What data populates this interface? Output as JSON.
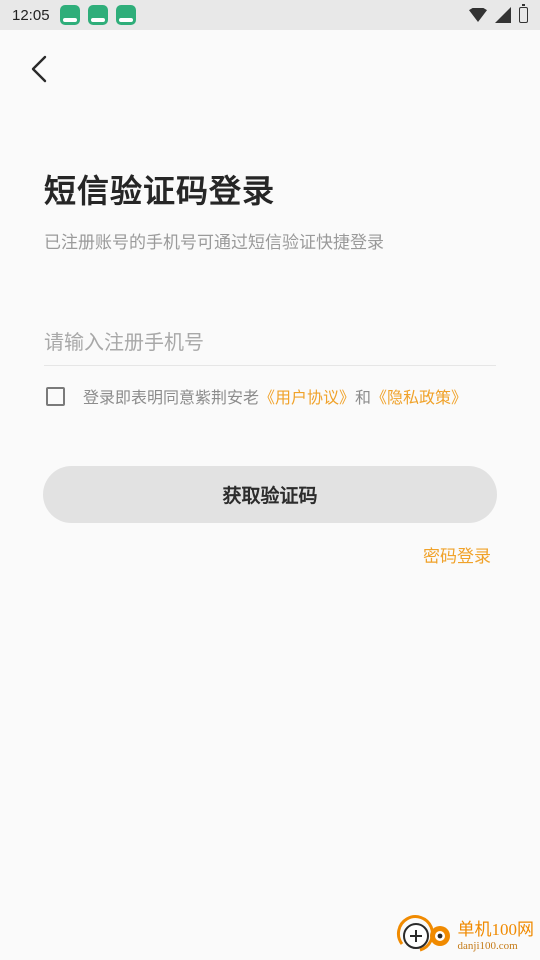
{
  "status_bar": {
    "time": "12:05",
    "notification_icons": [
      "app-notification-icon",
      "app-notification-icon",
      "app-notification-icon"
    ]
  },
  "header": {
    "back_icon": "chevron-left-icon"
  },
  "main": {
    "title": "短信验证码登录",
    "subtitle": "已注册账号的手机号可通过短信验证快捷登录",
    "phone_input": {
      "placeholder": "请输入注册手机号",
      "value": ""
    },
    "agreement": {
      "checked": false,
      "prefix": "登录即表明同意紫荆安老",
      "user_agreement": "《用户协议》",
      "conjunction": "和",
      "privacy_policy": "《隐私政策》"
    },
    "get_code_label": "获取验证码",
    "password_login_label": "密码登录"
  },
  "watermark": {
    "title": "单机100网",
    "domain": "danji100.com"
  },
  "colors": {
    "accent": "#f0a22a",
    "button_bg": "#e2e2e2",
    "background": "#fafafa"
  }
}
